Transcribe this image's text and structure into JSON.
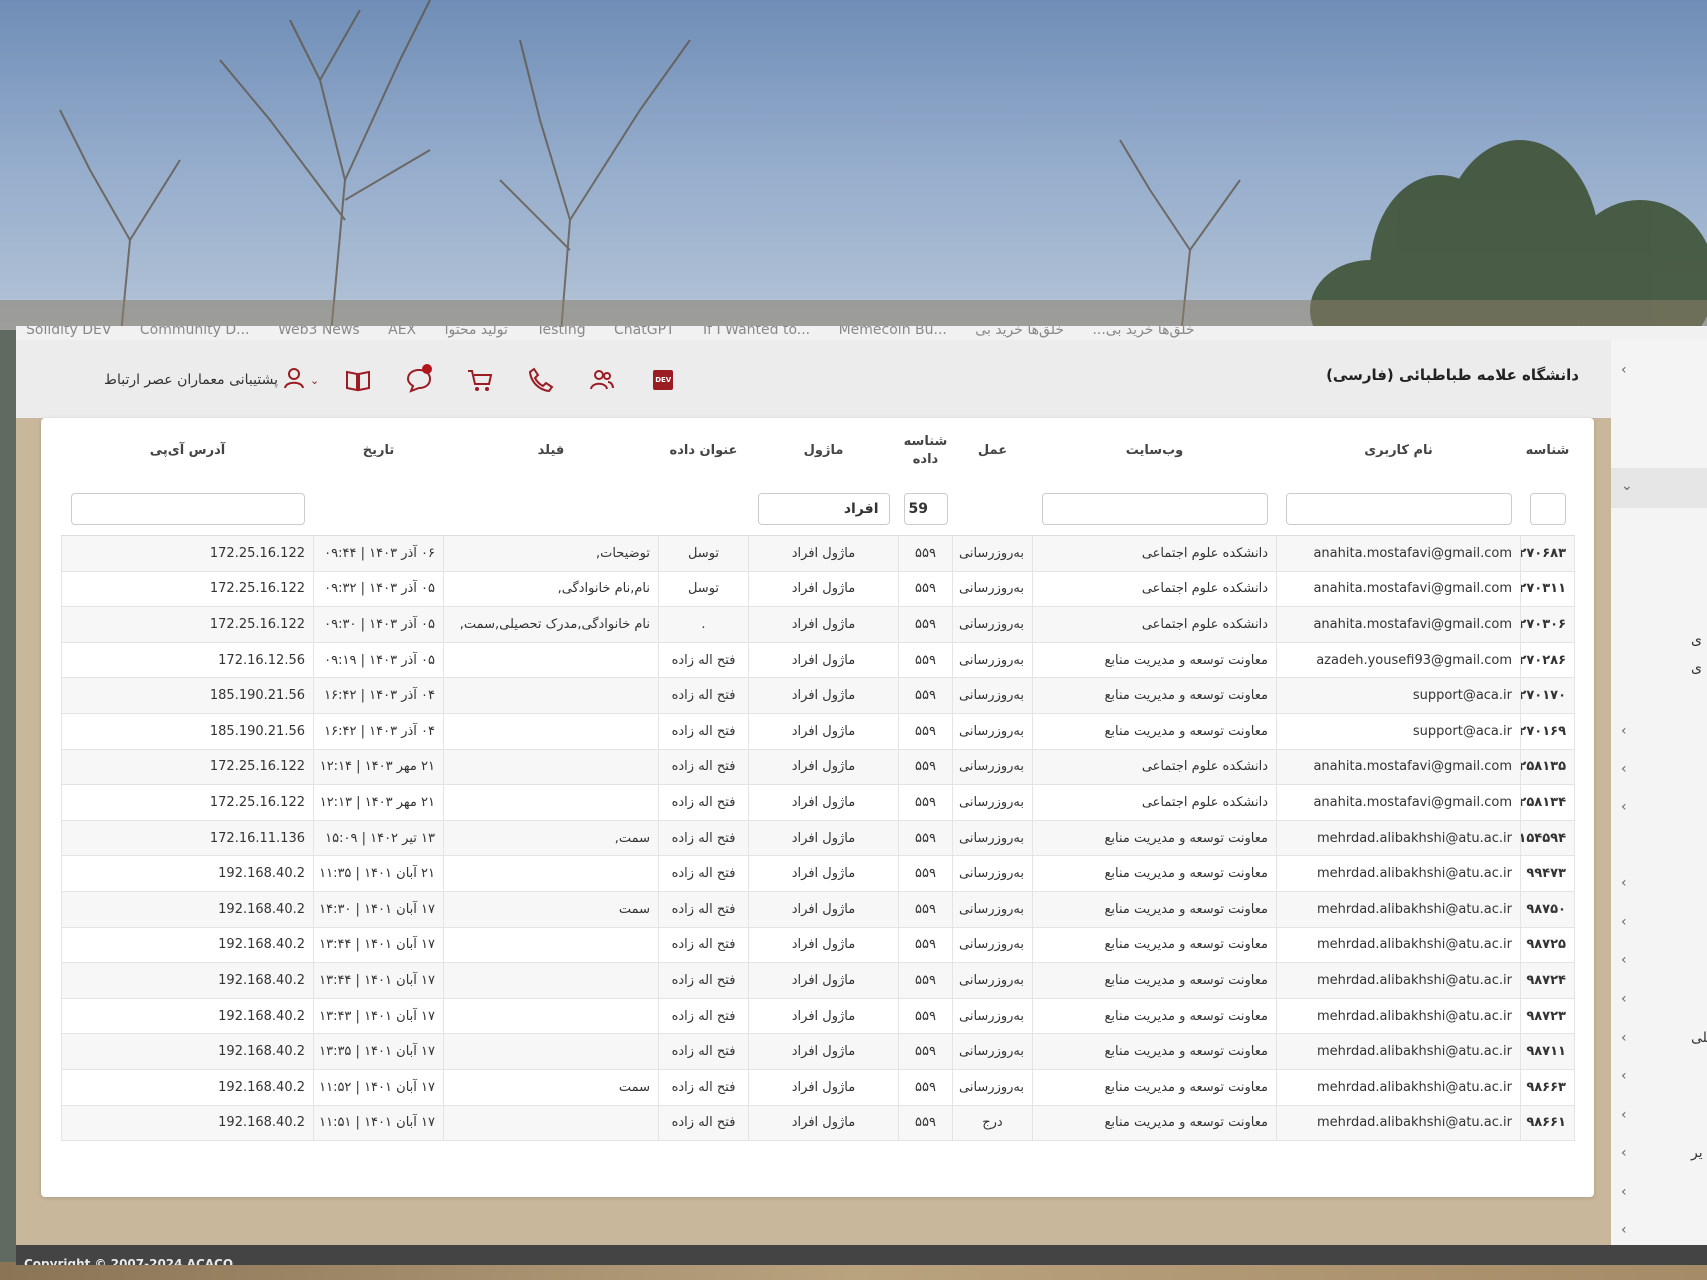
{
  "bookmarks": [
    "Solidity DEV",
    "Community D...",
    "Web3 News",
    "AEX",
    "تولید محتوا",
    "Testing",
    "ChatGPT",
    "If I Wanted to...",
    "Memecoin Bu...",
    "خلق‌ها خرید بی...",
    "خلق‌ها خرید بی"
  ],
  "header": {
    "brand": "دانشگاه علامه طباطبائی (فارسی)",
    "user_label": "پشتیبانی معماران عصر ارتباط",
    "dev_badge": "DEV",
    "icons": [
      "dev-icon",
      "users-icon",
      "phone-icon",
      "cart-icon",
      "chat-icon",
      "book-icon",
      "user-icon"
    ],
    "brand_color": "#9c1c24"
  },
  "sidenav": {
    "partial_labels": [
      "ی",
      "ی",
      "صیلی",
      "یر"
    ]
  },
  "table": {
    "columns": [
      "شناسه",
      "نام کاربری",
      "وب‌سایت",
      "عمل",
      "شناسه داده",
      "ماژول",
      "عنوان داده",
      "فیلد",
      "تاریخ",
      "آدرس آی‌پی"
    ],
    "filters": {
      "data_id": "59",
      "module": "افراد"
    },
    "rows": [
      {
        "id": "۲۷۰۶۸۳",
        "user": "anahita.mostafavi@gmail.com",
        "site": "دانشکده علوم اجتماعی",
        "action": "به‌روزرسانی",
        "data_id": "۵۵۹",
        "module": "ماژول افراد",
        "title": "توسل",
        "field": "توضیحات,",
        "date": "۰۶ آذر ۱۴۰۳ | ۰۹:۴۴",
        "ip": "172.25.16.122"
      },
      {
        "id": "۲۷۰۳۱۱",
        "user": "anahita.mostafavi@gmail.com",
        "site": "دانشکده علوم اجتماعی",
        "action": "به‌روزرسانی",
        "data_id": "۵۵۹",
        "module": "ماژول افراد",
        "title": "توسل",
        "field": "نام,نام خانوادگی,",
        "date": "۰۵ آذر ۱۴۰۳ | ۰۹:۳۲",
        "ip": "172.25.16.122"
      },
      {
        "id": "۲۷۰۳۰۶",
        "user": "anahita.mostafavi@gmail.com",
        "site": "دانشکده علوم اجتماعی",
        "action": "به‌روزرسانی",
        "data_id": "۵۵۹",
        "module": "ماژول افراد",
        "title": ".",
        "field": "نام خانوادگی,مدرک تحصیلی,سمت,",
        "date": "۰۵ آذر ۱۴۰۳ | ۰۹:۳۰",
        "ip": "172.25.16.122"
      },
      {
        "id": "۲۷۰۲۸۶",
        "user": "azadeh.yousefi93@gmail.com",
        "site": "معاونت توسعه و مدیریت منابع",
        "action": "به‌روزرسانی",
        "data_id": "۵۵۹",
        "module": "ماژول افراد",
        "title": "فتح اله زاده",
        "field": "",
        "date": "۰۵ آذر ۱۴۰۳ | ۰۹:۱۹",
        "ip": "172.16.12.56"
      },
      {
        "id": "۲۷۰۱۷۰",
        "user": "support@aca.ir",
        "site": "معاونت توسعه و مدیریت منابع",
        "action": "به‌روزرسانی",
        "data_id": "۵۵۹",
        "module": "ماژول افراد",
        "title": "فتح اله زاده",
        "field": "",
        "date": "۰۴ آذر ۱۴۰۳ | ۱۶:۴۲",
        "ip": "185.190.21.56"
      },
      {
        "id": "۲۷۰۱۶۹",
        "user": "support@aca.ir",
        "site": "معاونت توسعه و مدیریت منابع",
        "action": "به‌روزرسانی",
        "data_id": "۵۵۹",
        "module": "ماژول افراد",
        "title": "فتح اله زاده",
        "field": "",
        "date": "۰۴ آذر ۱۴۰۳ | ۱۶:۴۲",
        "ip": "185.190.21.56"
      },
      {
        "id": "۲۵۸۱۳۵",
        "user": "anahita.mostafavi@gmail.com",
        "site": "دانشکده علوم اجتماعی",
        "action": "به‌روزرسانی",
        "data_id": "۵۵۹",
        "module": "ماژول افراد",
        "title": "فتح اله زاده",
        "field": "",
        "date": "۲۱ مهر ۱۴۰۳ | ۱۲:۱۴",
        "ip": "172.25.16.122"
      },
      {
        "id": "۲۵۸۱۳۴",
        "user": "anahita.mostafavi@gmail.com",
        "site": "دانشکده علوم اجتماعی",
        "action": "به‌روزرسانی",
        "data_id": "۵۵۹",
        "module": "ماژول افراد",
        "title": "فتح اله زاده",
        "field": "",
        "date": "۲۱ مهر ۱۴۰۳ | ۱۲:۱۳",
        "ip": "172.25.16.122"
      },
      {
        "id": "۱۵۴۵۹۴",
        "user": "mehrdad.alibakhshi@atu.ac.ir",
        "site": "معاونت توسعه و مدیریت منابع",
        "action": "به‌روزرسانی",
        "data_id": "۵۵۹",
        "module": "ماژول افراد",
        "title": "فتح اله زاده",
        "field": "سمت,",
        "date": "۱۳ تیر ۱۴۰۲ | ۱۵:۰۹",
        "ip": "172.16.11.136"
      },
      {
        "id": "۹۹۴۷۳",
        "user": "mehrdad.alibakhshi@atu.ac.ir",
        "site": "معاونت توسعه و مدیریت منابع",
        "action": "به‌روزرسانی",
        "data_id": "۵۵۹",
        "module": "ماژول افراد",
        "title": "فتح اله زاده",
        "field": "",
        "date": "۲۱ آبان ۱۴۰۱ | ۱۱:۳۵",
        "ip": "192.168.40.2"
      },
      {
        "id": "۹۸۷۵۰",
        "user": "mehrdad.alibakhshi@atu.ac.ir",
        "site": "معاونت توسعه و مدیریت منابع",
        "action": "به‌روزرسانی",
        "data_id": "۵۵۹",
        "module": "ماژول افراد",
        "title": "فتح اله زاده",
        "field": "سمت",
        "date": "۱۷ آبان ۱۴۰۱ | ۱۴:۳۰",
        "ip": "192.168.40.2"
      },
      {
        "id": "۹۸۷۲۵",
        "user": "mehrdad.alibakhshi@atu.ac.ir",
        "site": "معاونت توسعه و مدیریت منابع",
        "action": "به‌روزرسانی",
        "data_id": "۵۵۹",
        "module": "ماژول افراد",
        "title": "فتح اله زاده",
        "field": "",
        "date": "۱۷ آبان ۱۴۰۱ | ۱۳:۴۴",
        "ip": "192.168.40.2"
      },
      {
        "id": "۹۸۷۲۴",
        "user": "mehrdad.alibakhshi@atu.ac.ir",
        "site": "معاونت توسعه و مدیریت منابع",
        "action": "به‌روزرسانی",
        "data_id": "۵۵۹",
        "module": "ماژول افراد",
        "title": "فتح اله زاده",
        "field": "",
        "date": "۱۷ آبان ۱۴۰۱ | ۱۳:۴۴",
        "ip": "192.168.40.2"
      },
      {
        "id": "۹۸۷۲۳",
        "user": "mehrdad.alibakhshi@atu.ac.ir",
        "site": "معاونت توسعه و مدیریت منابع",
        "action": "به‌روزرسانی",
        "data_id": "۵۵۹",
        "module": "ماژول افراد",
        "title": "فتح اله زاده",
        "field": "",
        "date": "۱۷ آبان ۱۴۰۱ | ۱۳:۴۳",
        "ip": "192.168.40.2"
      },
      {
        "id": "۹۸۷۱۱",
        "user": "mehrdad.alibakhshi@atu.ac.ir",
        "site": "معاونت توسعه و مدیریت منابع",
        "action": "به‌روزرسانی",
        "data_id": "۵۵۹",
        "module": "ماژول افراد",
        "title": "فتح اله زاده",
        "field": "",
        "date": "۱۷ آبان ۱۴۰۱ | ۱۳:۳۵",
        "ip": "192.168.40.2"
      },
      {
        "id": "۹۸۶۶۳",
        "user": "mehrdad.alibakhshi@atu.ac.ir",
        "site": "معاونت توسعه و مدیریت منابع",
        "action": "به‌روزرسانی",
        "data_id": "۵۵۹",
        "module": "ماژول افراد",
        "title": "فتح اله زاده",
        "field": "سمت",
        "date": "۱۷ آبان ۱۴۰۱ | ۱۱:۵۲",
        "ip": "192.168.40.2"
      },
      {
        "id": "۹۸۶۶۱",
        "user": "mehrdad.alibakhshi@atu.ac.ir",
        "site": "معاونت توسعه و مدیریت منابع",
        "action": "درج",
        "data_id": "۵۵۹",
        "module": "ماژول افراد",
        "title": "فتح اله زاده",
        "field": "",
        "date": "۱۷ آبان ۱۴۰۱ | ۱۱:۵۱",
        "ip": "192.168.40.2"
      }
    ]
  },
  "footer": {
    "copyright": "Copyright © 2007-2024 ACACO"
  }
}
